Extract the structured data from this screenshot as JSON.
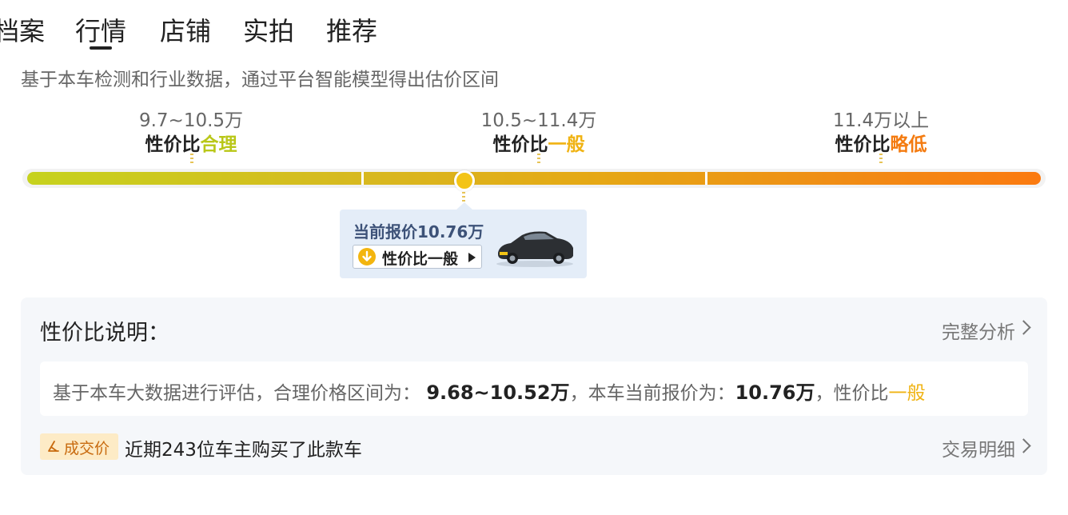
{
  "tabs": [
    {
      "label": "档案"
    },
    {
      "label": "行情"
    },
    {
      "label": "店铺"
    },
    {
      "label": "实拍"
    },
    {
      "label": "推荐"
    }
  ],
  "active_tab": "行情",
  "subtitle": "基于本车检测和行业数据，通过平台智能模型得出估价区间",
  "segments": [
    {
      "price": "9.7~10.5万",
      "prefix": "性价比",
      "level": "合理",
      "color": "#b9c718"
    },
    {
      "price": "10.5~11.4万",
      "prefix": "性价比",
      "level": "一般",
      "color": "#f0b313"
    },
    {
      "price": "11.4万以上",
      "prefix": "性价比",
      "level": "略低",
      "color": "#f47b10"
    }
  ],
  "colors": {
    "accent": "#f3c416",
    "bar_start": "#c6d21e",
    "bar_end": "#fb7a10"
  },
  "tooltip": {
    "title": "当前报价10.76万",
    "button_label": "性价比一般",
    "icon": "arrow-down-circle-icon"
  },
  "panel": {
    "title": "性价比说明：",
    "link": "完整分析",
    "info_prefix": "基于本车大数据进行评估，合理价格区间为：",
    "range": "9.68~10.52万",
    "info_mid": "，本车当前报价为：",
    "current": "10.76万",
    "info_sep": "，性价比",
    "level": "一般",
    "trade_badge": "成交价",
    "trade_text": "近期243位车主购买了此款车",
    "trade_link": "交易明细"
  }
}
